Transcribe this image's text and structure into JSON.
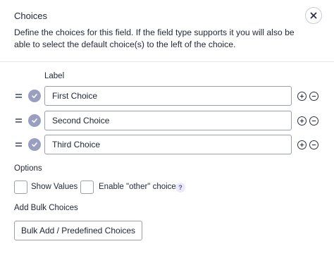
{
  "header": {
    "title": "Choices",
    "description": "Define the choices for this field. If the field type supports it you will also be able to select the default choice(s) to the left of the choice.",
    "close_icon": "close-icon"
  },
  "choices": {
    "column_label": "Label",
    "items": [
      {
        "value": "First Choice"
      },
      {
        "value": "Second Choice"
      },
      {
        "value": "Third Choice"
      }
    ],
    "drag_icon": "drag-handle-icon",
    "check_icon": "check-icon",
    "add_icon": "plus-icon",
    "remove_icon": "minus-icon"
  },
  "options": {
    "title": "Options",
    "show_values_label": "Show Values",
    "enable_other_label": "Enable \"other\" choice",
    "help_glyph": "?"
  },
  "bulk": {
    "title": "Add Bulk Choices",
    "button_label": "Bulk Add / Predefined Choices"
  },
  "colors": {
    "accent": "#9a9fc0",
    "border": "#9ca1b0",
    "help_bg": "#eceaf8",
    "help_fg": "#4a4ea8"
  }
}
